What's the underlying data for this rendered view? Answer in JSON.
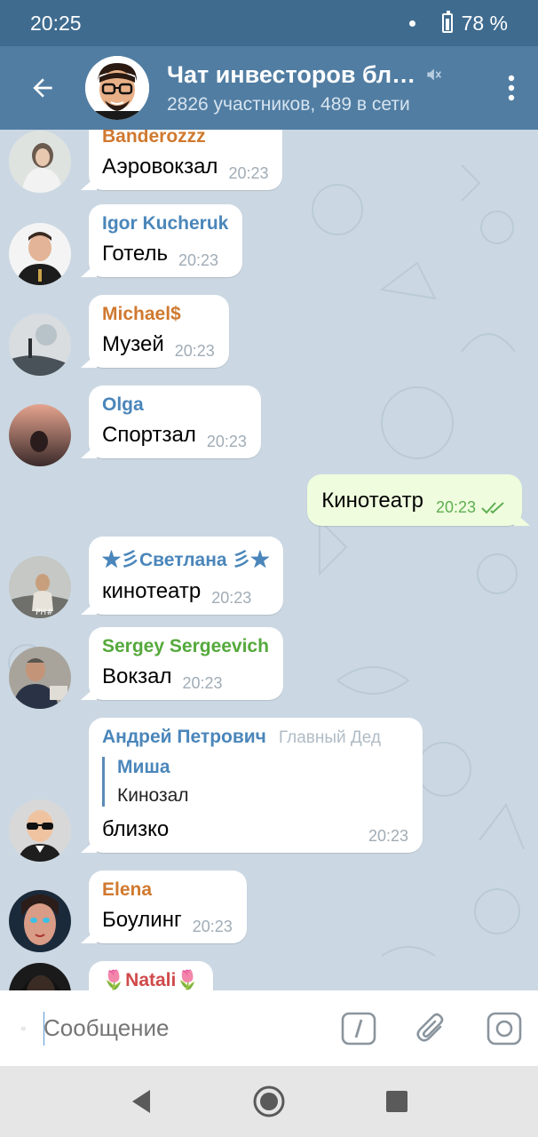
{
  "status_bar": {
    "time": "20:25",
    "battery": "78 %"
  },
  "header": {
    "title": "Чат инвесторов бл…",
    "subtitle": "2826 участников, 489 в сети"
  },
  "messages": [
    {
      "sender": "Banderozzz",
      "sender_color": "#d0792f",
      "text": "Аэровокзал",
      "time": "20:23"
    },
    {
      "sender": "Igor Kucheruk",
      "sender_color": "#4a86ba",
      "text": "Готель",
      "time": "20:23"
    },
    {
      "sender": "Michael$",
      "sender_color": "#d0792f",
      "text": "Музей",
      "time": "20:23"
    },
    {
      "sender": "Olga",
      "sender_color": "#4a86ba",
      "text": "Спортзал",
      "time": "20:23"
    },
    {
      "own": true,
      "text": "Кинотеатр",
      "time": "20:23"
    },
    {
      "sender": "★彡Светлана 彡★",
      "sender_color": "#4a86ba",
      "text": "кинотеатр",
      "time": "20:23"
    },
    {
      "sender": "Sergey Sergeevich",
      "sender_color": "#55a93c",
      "text": "Вокзал",
      "time": "20:23"
    },
    {
      "sender": "Андрей Петрович",
      "sender_color": "#4a86ba",
      "admin_title": "Главный Дед",
      "reply_name": "Миша",
      "reply_text": "Кинозал",
      "text": "близко",
      "time": "20:23"
    },
    {
      "sender": "Elena",
      "sender_color": "#d0792f",
      "text": "Боулинг",
      "time": "20:23"
    },
    {
      "sender": "🌷Natali🌷",
      "sender_color": "#d04a4a"
    }
  ],
  "input": {
    "placeholder": "Сообщение"
  },
  "icons": {
    "back": "arrow-left-icon",
    "menu": "more-vertical-icon",
    "muted": "muted-icon",
    "emoji": "emoji-icon",
    "commands": "slash-command-icon",
    "attach": "paperclip-icon",
    "camera": "camera-icon"
  }
}
